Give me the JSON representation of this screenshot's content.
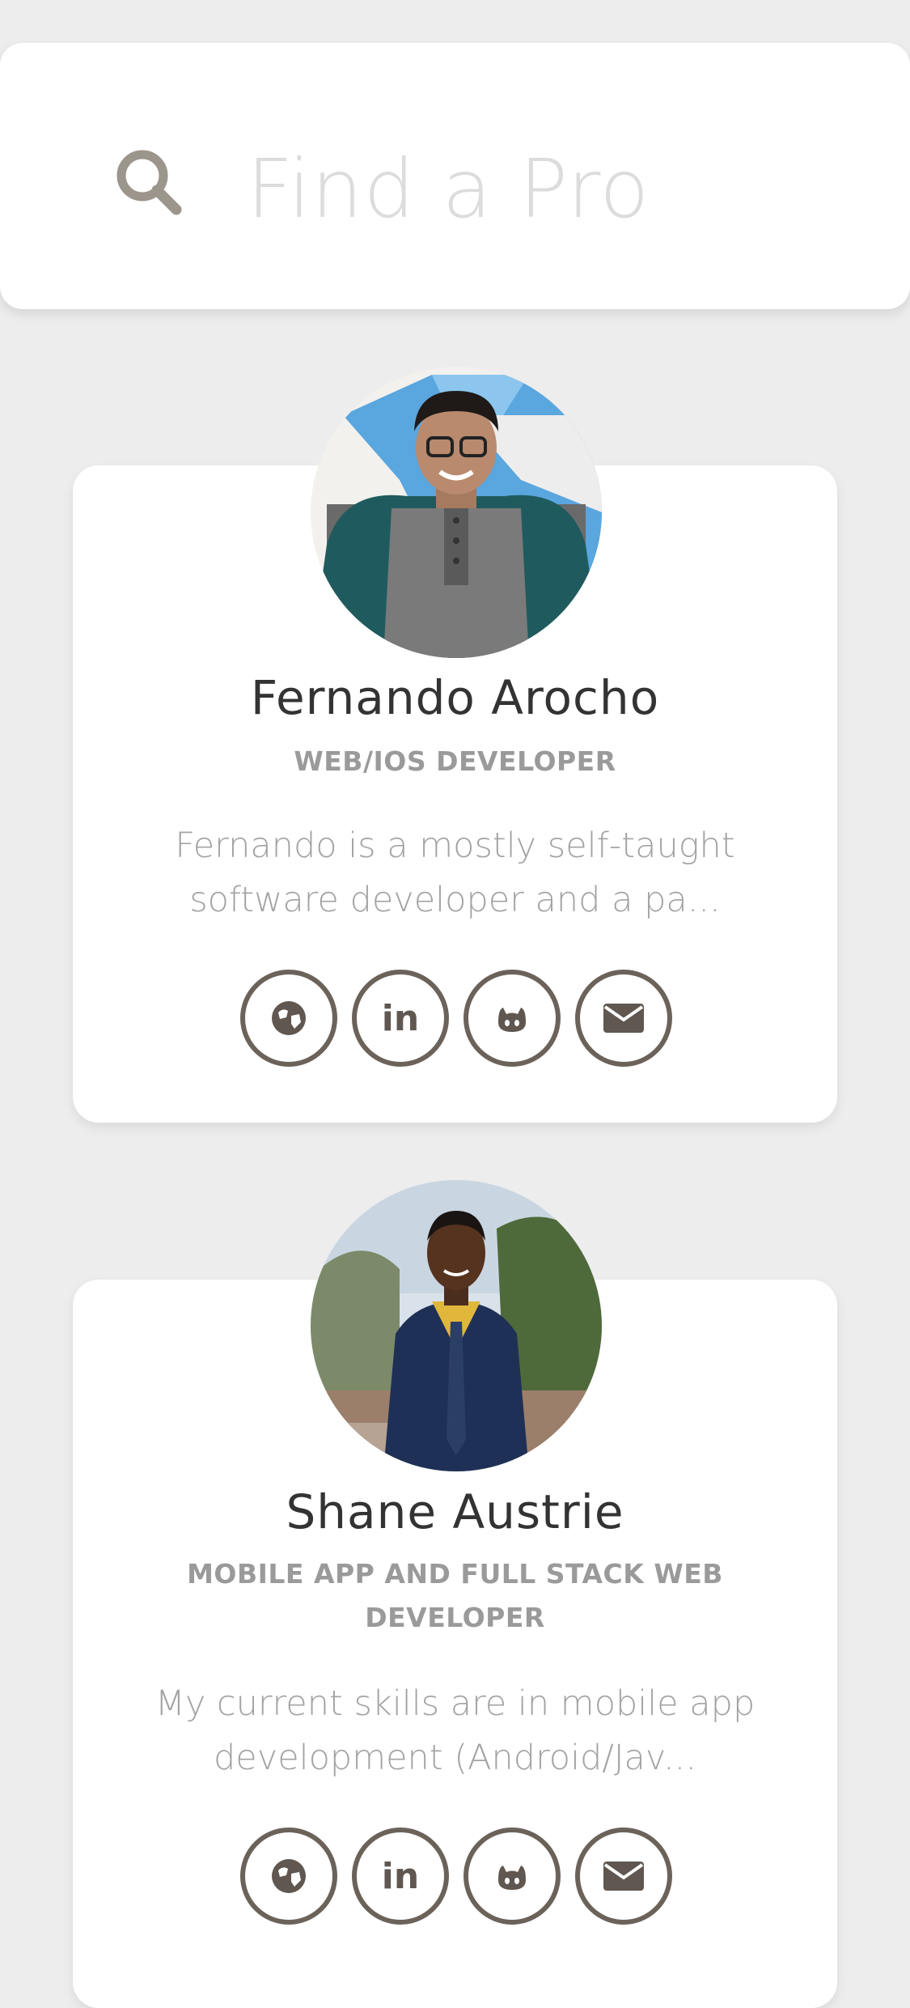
{
  "search": {
    "placeholder": "Find a Pro",
    "icon": "search-icon"
  },
  "profiles": [
    {
      "name": "Fernando Arocho",
      "role": "WEB/IOS DEVELOPER",
      "bio_line1": "Fernando is a mostly self-taught",
      "bio_line2": "software developer and a pa...",
      "links": [
        "globe-icon",
        "linkedin-icon",
        "github-icon",
        "email-icon"
      ]
    },
    {
      "name": "Shane Austrie",
      "role_line1": "MOBILE APP AND FULL STACK WEB",
      "role_line2": "DEVELOPER",
      "bio_line1": "My current skills are in mobile app",
      "bio_line2": "development (Android/Jav...",
      "links": [
        "globe-icon",
        "linkedin-icon",
        "github-icon",
        "email-icon"
      ]
    }
  ],
  "colors": {
    "background": "#ededed",
    "card": "#ffffff",
    "icon_stroke": "#6b625a",
    "name_text": "#333333",
    "role_text": "#9a9a9a",
    "bio_text": "#a3a3a3"
  }
}
